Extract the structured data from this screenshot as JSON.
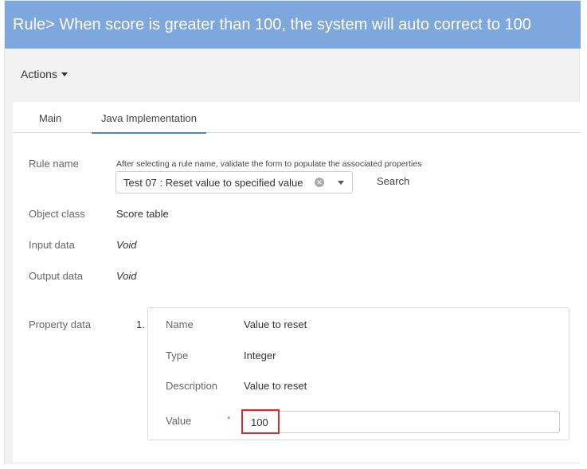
{
  "header": {
    "title": "Rule> When score is greater than 100, the system will auto correct to 100"
  },
  "actions": {
    "label": "Actions"
  },
  "tabs": [
    {
      "label": "Main",
      "active": false
    },
    {
      "label": "Java Implementation",
      "active": true
    }
  ],
  "form": {
    "rule_name": {
      "label": "Rule name",
      "hint": "After selecting a rule name, validate the form to populate the associated properties",
      "selected": "Test 07 : Reset value to specified value",
      "search_label": "Search"
    },
    "object_class": {
      "label": "Object class",
      "value": "Score table"
    },
    "input_data": {
      "label": "Input data",
      "value": "Void"
    },
    "output_data": {
      "label": "Output data",
      "value": "Void"
    },
    "property_data": {
      "label": "Property data",
      "items": [
        {
          "number": "1.",
          "name_label": "Name",
          "name": "Value to reset",
          "type_label": "Type",
          "type": "Integer",
          "description_label": "Description",
          "description": "Value to reset",
          "value_label": "Value",
          "required_marker": "*",
          "value": "100"
        }
      ]
    }
  },
  "colors": {
    "header_bg": "#7da7dd",
    "tab_active": "#4a86c8",
    "required": "#d9534f",
    "highlight": "#d32f2f"
  },
  "icons": {
    "actions_caret": "caret-down-icon",
    "select_clear": "clear-icon",
    "select_caret": "chevron-down-icon"
  }
}
